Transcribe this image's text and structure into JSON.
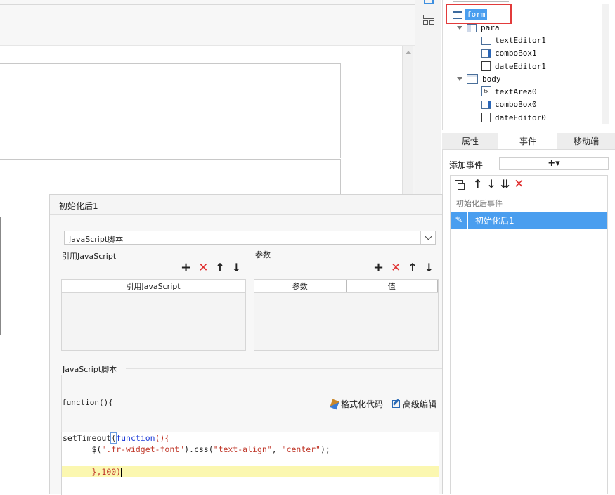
{
  "tree": {
    "root": "form",
    "para": "para",
    "para_children": [
      "textEditor1",
      "comboBox1",
      "dateEditor1"
    ],
    "body": "body",
    "body_children": [
      "textArea0",
      "comboBox0",
      "dateEditor0"
    ]
  },
  "right_tabs": [
    "属性",
    "事件",
    "移动端"
  ],
  "right_panel": {
    "add_event_label": "添加事件",
    "add_icon": "+▾",
    "event_group": "初始化后事件",
    "event_item": "初始化后1"
  },
  "dialog": {
    "title": "初始化后1",
    "script_type": "JavaScript脚本",
    "ref_js_section": "引用JavaScript",
    "params_section": "参数",
    "ref_js_column": "引用JavaScript",
    "params_columns": [
      "参数",
      "值"
    ],
    "js_script_section": "JavaScript脚本",
    "function_header": "function(){",
    "format_code": "格式化代码",
    "advanced_edit": "高级编辑",
    "code_lines": {
      "l1_a": "setTimeout",
      "l1_b": "(",
      "l1_c": "function",
      "l1_d": "(){",
      "l2_a": "      $(",
      "l2_b": "\".fr-widget-font\"",
      "l2_c": ").css(",
      "l2_d": "\"text-align\"",
      "l2_e": ", ",
      "l2_f": "\"center\"",
      "l2_g": ");",
      "l4_a": "      },",
      "l4_b": "100",
      "l4_c": ")"
    }
  },
  "colors": {
    "accent": "#3d8fe0",
    "selected_bg": "#4a9eef",
    "highlight_line": "#fbf7b0",
    "red": "#e03030",
    "string": "#c0392b",
    "keyword": "#1f3cd6"
  }
}
